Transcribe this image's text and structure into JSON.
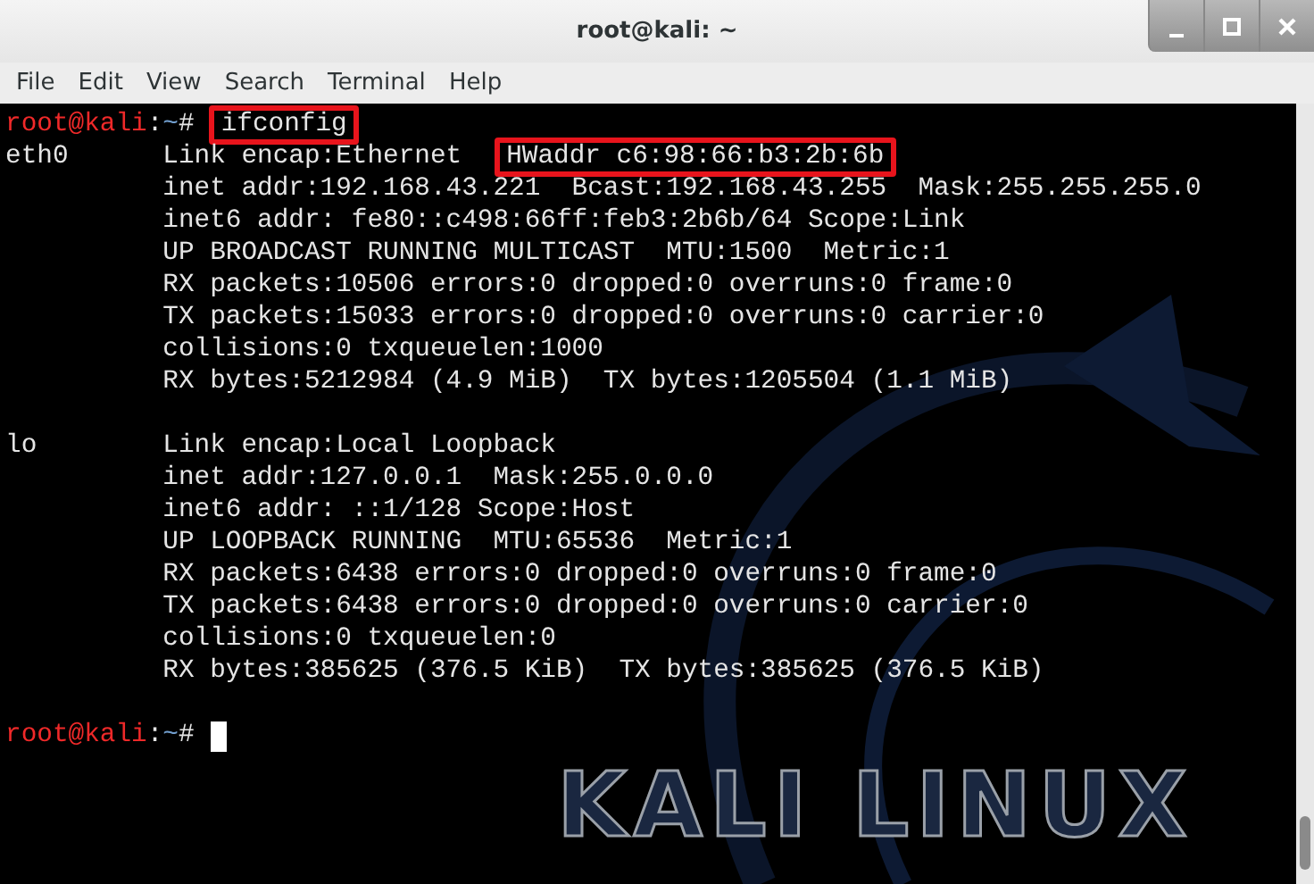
{
  "window": {
    "title": "root@kali: ~"
  },
  "menu": [
    "File",
    "Edit",
    "View",
    "Search",
    "Terminal",
    "Help"
  ],
  "terminal": {
    "lines": [
      {
        "kind": "prompt",
        "user_host": "root@kali",
        "separator": ":",
        "path": "~",
        "symbol": "#",
        "command": "ifconfig",
        "highlighted": true
      },
      {
        "kind": "output",
        "label": "eth0",
        "segments": [
          {
            "text": "Link encap:Ethernet",
            "highlighted": false
          },
          {
            "text": "HWaddr c6:98:66:b3:2b:6b",
            "highlighted": true
          }
        ]
      },
      {
        "kind": "output",
        "segments": [
          {
            "text": "inet addr:192.168.43.221  Bcast:192.168.43.255  Mask:255.255.255.0",
            "highlighted": false
          }
        ]
      },
      {
        "kind": "output",
        "segments": [
          {
            "text": "inet6 addr: fe80::c498:66ff:feb3:2b6b/64 Scope:Link",
            "highlighted": false
          }
        ]
      },
      {
        "kind": "output",
        "segments": [
          {
            "text": "UP BROADCAST RUNNING MULTICAST  MTU:1500  Metric:1",
            "highlighted": false
          }
        ]
      },
      {
        "kind": "output",
        "segments": [
          {
            "text": "RX packets:10506 errors:0 dropped:0 overruns:0 frame:0",
            "highlighted": false
          }
        ]
      },
      {
        "kind": "output",
        "segments": [
          {
            "text": "TX packets:15033 errors:0 dropped:0 overruns:0 carrier:0",
            "highlighted": false
          }
        ]
      },
      {
        "kind": "output",
        "segments": [
          {
            "text": "collisions:0 txqueuelen:1000",
            "highlighted": false
          }
        ]
      },
      {
        "kind": "output",
        "segments": [
          {
            "text": "RX bytes:5212984 (4.9 MiB)  TX bytes:1205504 (1.1 MiB)",
            "highlighted": false
          }
        ]
      },
      {
        "kind": "blank"
      },
      {
        "kind": "output",
        "label": "lo",
        "segments": [
          {
            "text": "Link encap:Local Loopback",
            "highlighted": false
          }
        ]
      },
      {
        "kind": "output",
        "segments": [
          {
            "text": "inet addr:127.0.0.1  Mask:255.0.0.0",
            "highlighted": false
          }
        ]
      },
      {
        "kind": "output",
        "segments": [
          {
            "text": "inet6 addr: ::1/128 Scope:Host",
            "highlighted": false
          }
        ]
      },
      {
        "kind": "output",
        "segments": [
          {
            "text": "UP LOOPBACK RUNNING  MTU:65536  Metric:1",
            "highlighted": false
          }
        ]
      },
      {
        "kind": "output",
        "segments": [
          {
            "text": "RX packets:6438 errors:0 dropped:0 overruns:0 frame:0",
            "highlighted": false
          }
        ]
      },
      {
        "kind": "output",
        "segments": [
          {
            "text": "TX packets:6438 errors:0 dropped:0 overruns:0 carrier:0",
            "highlighted": false
          }
        ]
      },
      {
        "kind": "output",
        "segments": [
          {
            "text": "collisions:0 txqueuelen:0",
            "highlighted": false
          }
        ]
      },
      {
        "kind": "output",
        "segments": [
          {
            "text": "RX bytes:385625 (376.5 KiB)  TX bytes:385625 (376.5 KiB)",
            "highlighted": false
          }
        ]
      },
      {
        "kind": "blank"
      },
      {
        "kind": "prompt",
        "user_host": "root@kali",
        "separator": ":",
        "path": "~",
        "symbol": "#",
        "cursor": true
      }
    ],
    "wallpaper_text": "KALI LINUX"
  }
}
